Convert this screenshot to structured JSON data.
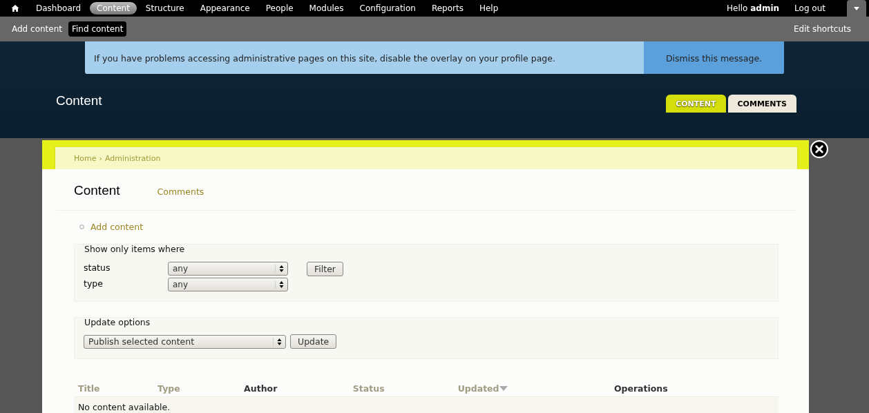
{
  "toolbar": {
    "menu": [
      {
        "label": "Dashboard",
        "selected": false
      },
      {
        "label": "Content",
        "selected": true
      },
      {
        "label": "Structure",
        "selected": false
      },
      {
        "label": "Appearance",
        "selected": false
      },
      {
        "label": "People",
        "selected": false
      },
      {
        "label": "Modules",
        "selected": false
      },
      {
        "label": "Configuration",
        "selected": false
      },
      {
        "label": "Reports",
        "selected": false
      },
      {
        "label": "Help",
        "selected": false
      }
    ],
    "greeting": "Hello **admin**",
    "logout": "Log out"
  },
  "shortcuts": {
    "items": [
      {
        "label": "Add content",
        "selected": false
      },
      {
        "label": "Find content",
        "selected": true
      }
    ],
    "edit": "Edit shortcuts"
  },
  "message": {
    "text": "If you have problems accessing administrative pages on this site, disable the overlay on your profile page.",
    "dismiss": "Dismiss this message."
  },
  "page_title": "Content",
  "overlay_tabs": [
    {
      "label": "CONTENT",
      "selected": true
    },
    {
      "label": "COMMENTS",
      "selected": false
    }
  ],
  "breadcrumb": [
    "Home",
    "›",
    "Administration"
  ],
  "overlay": {
    "title": "Content",
    "secondary_tabs": [
      {
        "label": "Comments",
        "selected": false
      }
    ],
    "action_link": "Add content",
    "filter": {
      "legend": "Show only items where",
      "fields": [
        {
          "label": "status",
          "value": "any"
        },
        {
          "label": "type",
          "value": "any"
        }
      ],
      "button": "Filter"
    },
    "update": {
      "legend": "Update options",
      "value": "Publish selected content",
      "button": "Update"
    },
    "table": {
      "columns": [
        {
          "label": "Title",
          "sortable": true,
          "sorted": false
        },
        {
          "label": "Type",
          "sortable": true,
          "sorted": false
        },
        {
          "label": "Author",
          "sortable": false,
          "sorted": false
        },
        {
          "label": "Status",
          "sortable": true,
          "sorted": false
        },
        {
          "label": "Updated",
          "sortable": true,
          "sorted": true
        },
        {
          "label": "Operations",
          "sortable": false,
          "sorted": false
        }
      ],
      "empty": "No content available."
    }
  }
}
